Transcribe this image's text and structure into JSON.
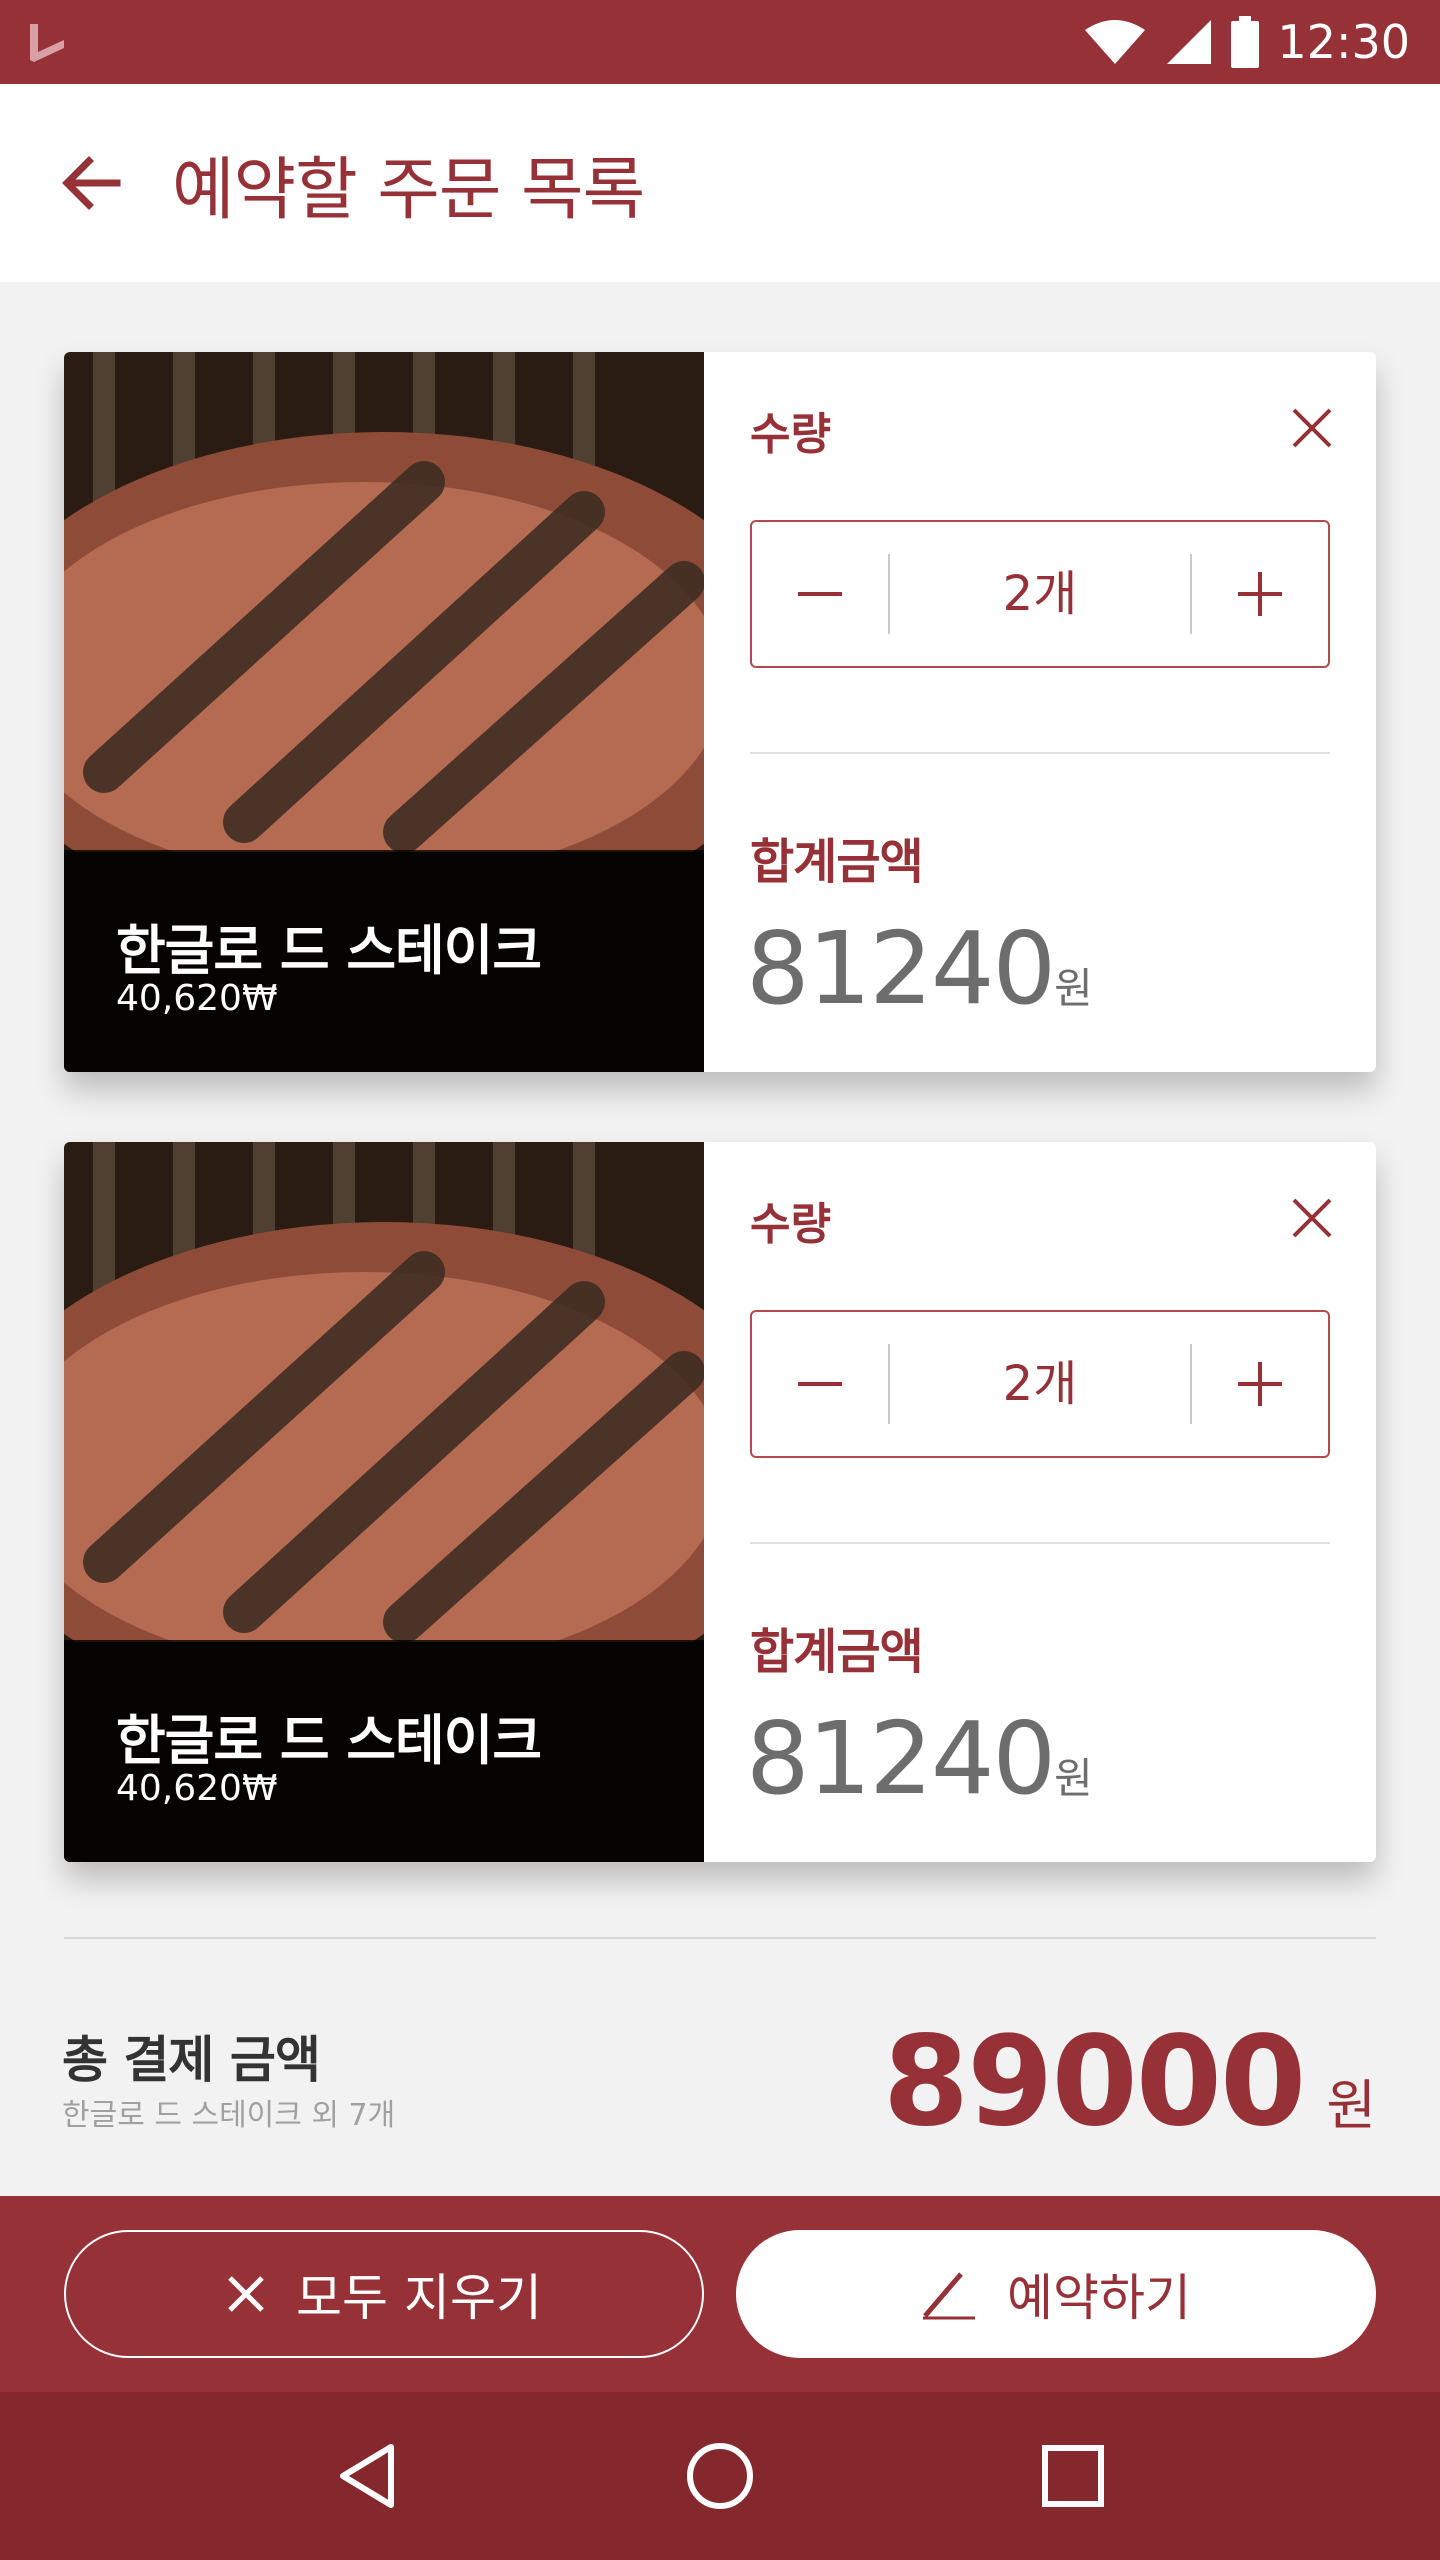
{
  "status_bar": {
    "time": "12:30",
    "icons": [
      "app-logo-icon",
      "wifi-icon",
      "cellular-signal-icon",
      "battery-icon"
    ]
  },
  "app_bar": {
    "title": "예약할 주문 목록",
    "back_icon": "arrow-left-icon"
  },
  "cart_items": [
    {
      "name": "한글로 드 스테이크",
      "price": "40,620₩",
      "quantity_label": "수량",
      "quantity": "2개",
      "subtotal_label": "합계금액",
      "subtotal": "81240",
      "subtotal_unit": "원"
    },
    {
      "name": "한글로 드 스테이크",
      "price": "40,620₩",
      "quantity_label": "수량",
      "quantity": "2개",
      "subtotal_label": "합계금액",
      "subtotal": "81240",
      "subtotal_unit": "원"
    }
  ],
  "summary": {
    "label": "총 결제 금액",
    "sub": "한글로 드 스테이크 외 7개",
    "total": "89000",
    "unit": "원"
  },
  "actions": {
    "clear_label": "모두 지우기",
    "reserve_label": "예약하기"
  },
  "colors": {
    "primary": "#963137",
    "nav_bar": "#85282e",
    "background": "#f2f2f2",
    "muted_text": "#6d6d6d"
  }
}
